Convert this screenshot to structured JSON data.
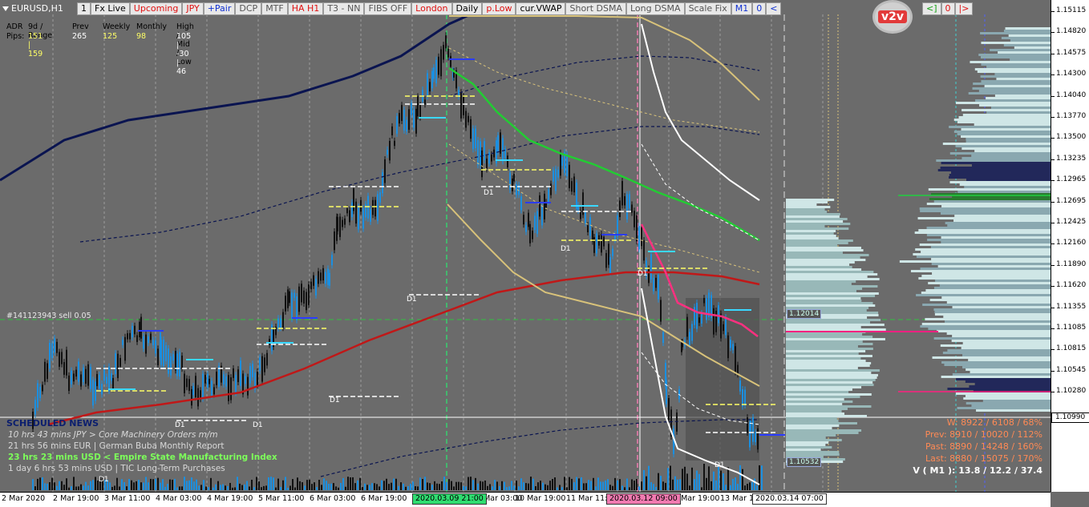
{
  "symbol": "EURUSD,H1",
  "toolbar": [
    {
      "label": "1",
      "color": "#000000"
    },
    {
      "label": "Fx Live",
      "color": "#000000"
    },
    {
      "label": "Upcoming",
      "color": "#e01010"
    },
    {
      "label": "JPY",
      "color": "#e01010"
    },
    {
      "label": "+Pair",
      "color": "#1030d0"
    },
    {
      "label": "DCP",
      "color": "#555555"
    },
    {
      "label": "MTF",
      "color": "#555555"
    },
    {
      "label": "HA H1",
      "color": "#e01010"
    },
    {
      "label": "T3 - NN",
      "color": "#555555"
    },
    {
      "label": "FIBS OFF",
      "color": "#555555"
    },
    {
      "label": "London",
      "color": "#e01010"
    },
    {
      "label": "Daily",
      "color": "#000000"
    },
    {
      "label": "p.Low",
      "color": "#e01010"
    },
    {
      "label": "cur.VWAP",
      "color": "#000000"
    },
    {
      "label": "Short DSMA",
      "color": "#555555"
    },
    {
      "label": "Long DSMA",
      "color": "#555555"
    },
    {
      "label": "Scale Fix",
      "color": "#555555"
    },
    {
      "label": "M1",
      "color": "#1030d0"
    },
    {
      "label": "0",
      "color": "#1030d0"
    },
    {
      "label": "<",
      "color": "#1030d0"
    }
  ],
  "toolbar_right": [
    {
      "label": "<]",
      "color": "#10a010"
    },
    {
      "label": "0",
      "color": "#e01010"
    },
    {
      "label": "|>",
      "color": "#e01010"
    }
  ],
  "badge": "v2v",
  "adr": {
    "headers": [
      "ADR",
      "9d / Range",
      "Prev",
      "Weekly",
      "Monthly",
      "High / Mid / Low"
    ],
    "row_label": "Pips:",
    "values": [
      "151 | 159",
      "265",
      "125",
      "98",
      "105  |  -30  |  46"
    ],
    "value_colors": [
      "#ffff66",
      "#ffffff",
      "#ffff66",
      "#ffff66",
      "#ffffff"
    ]
  },
  "order_label": "#141123943 sell 0.05",
  "news": {
    "title": "SCHEDULED NEWS",
    "items": [
      {
        "text": "10 hrs 43 mins  JPY  >  Core Machinery Orders m/m",
        "color": "#d8d8d8",
        "italic": true
      },
      {
        "text": "21 hrs 56 mins  EUR  |  German Buba Monthly Report",
        "color": "#d8d8d8",
        "italic": false
      },
      {
        "text": "23 hrs 23 mins  USD  <  Empire State Manufacturing Index",
        "color": "#7dff5a",
        "italic": false
      },
      {
        "text": "1 day 6 hrs 53 mins  USD  |  TIC Long-Term Purchases",
        "color": "#d8d8d8",
        "italic": false
      }
    ]
  },
  "stats": [
    {
      "text": "W: 8922 / 6108 / 68%",
      "color": "#ff8a55"
    },
    {
      "text": "Prev: 8910 / 10020 / 112%",
      "color": "#ff8a55"
    },
    {
      "text": "Past: 8890 / 14248 / 160%",
      "color": "#ff8a55"
    },
    {
      "text": "Last: 8880 / 15075 / 170%",
      "color": "#ff8a55"
    },
    {
      "text": "V ( M1 ): 13.8 / 12.2 / 37.4",
      "color": "#ffffff"
    }
  ],
  "price_scale": [
    "1.15115",
    "1.14820",
    "1.14575",
    "1.14300",
    "1.14040",
    "1.13770",
    "1.13500",
    "1.13235",
    "1.12965",
    "1.12695",
    "1.12425",
    "1.12160",
    "1.11890",
    "1.11620",
    "1.11355",
    "1.11085",
    "1.10815",
    "1.10545",
    "1.10280"
  ],
  "current_price": "1.10990",
  "time_labels": [
    "2 Mar 2020",
    "2 Mar 19:00",
    "3 Mar 11:00",
    "4 Mar 03:00",
    "4 Mar 19:00",
    "5 Mar 11:00",
    "6 Mar 03:00",
    "6 Mar 19:00",
    "9 Mar 03:00",
    "10 Mar 19:00",
    "11 Mar 11:00",
    "12 Mar 19:00",
    "13 Mar 11:00"
  ],
  "time_marks": [
    {
      "text": "2020.03.09 21:00",
      "bg": "#2fdc70"
    },
    {
      "text": "2020.03.12 09:00",
      "bg": "#f07ab0"
    },
    {
      "text": "2020.03.14 07:00",
      "bg": "#ffffff"
    }
  ],
  "chart_labels": {
    "d1": "D1",
    "level_1": "1.12014",
    "level_2": "1.10532"
  },
  "colors": {
    "background": "#6b6b6b",
    "candle": "#1b8fe0",
    "vwap_green": "#22cc33",
    "ma_red": "#c01818",
    "ma_navy": "#0a1450",
    "band_tan": "#d8c27a",
    "pink": "#ff3080"
  }
}
